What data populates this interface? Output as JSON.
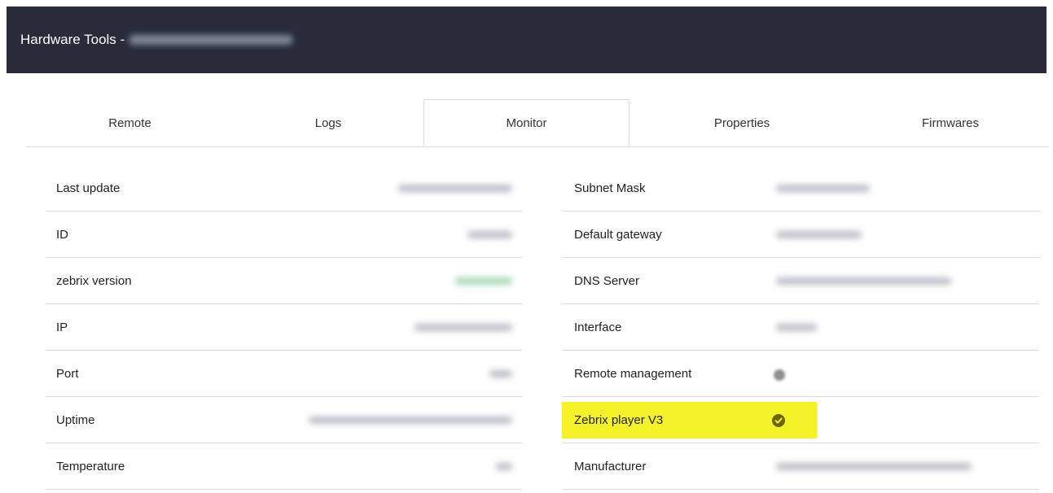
{
  "header": {
    "title": "Hardware Tools -"
  },
  "tabs": [
    {
      "label": "Remote",
      "active": false
    },
    {
      "label": "Logs",
      "active": false
    },
    {
      "label": "Monitor",
      "active": true
    },
    {
      "label": "Properties",
      "active": false
    },
    {
      "label": "Firmwares",
      "active": false
    }
  ],
  "left_rows": [
    {
      "label": "Last update"
    },
    {
      "label": "ID"
    },
    {
      "label": "zebrix version"
    },
    {
      "label": "IP"
    },
    {
      "label": "Port"
    },
    {
      "label": "Uptime"
    },
    {
      "label": "Temperature"
    }
  ],
  "right_rows": [
    {
      "label": "Subnet Mask"
    },
    {
      "label": "Default gateway"
    },
    {
      "label": "DNS Server"
    },
    {
      "label": "Interface"
    },
    {
      "label": "Remote management"
    },
    {
      "label": "Zebrix player V3"
    },
    {
      "label": "Manufacturer"
    }
  ],
  "colors": {
    "header_bg": "#272b3a",
    "highlight": "#f5f22a",
    "check": "#5b5b00"
  },
  "icons": {
    "zebrix_player_status": "check-circle-icon",
    "remote_management_status": "status-dot-icon"
  }
}
